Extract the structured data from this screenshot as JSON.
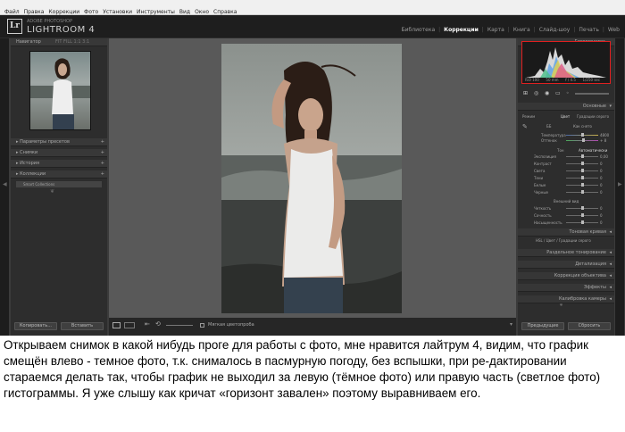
{
  "menu": [
    "Файл",
    "Правка",
    "Коррекции",
    "Фото",
    "Установки",
    "Инструменты",
    "Вид",
    "Окно",
    "Справка"
  ],
  "app": {
    "subtitle": "ADOBE PHOTOSHOP",
    "name": "LIGHTROOM 4",
    "logo": "Lr"
  },
  "modules": [
    {
      "label": "Библиотека",
      "active": false
    },
    {
      "label": "Коррекции",
      "active": true
    },
    {
      "label": "Карта",
      "active": false
    },
    {
      "label": "Книга",
      "active": false
    },
    {
      "label": "Слайд-шоу",
      "active": false
    },
    {
      "label": "Печать",
      "active": false
    },
    {
      "label": "Web",
      "active": false
    }
  ],
  "left_panel": {
    "navigator": {
      "title": "Навигатор",
      "zoom": "FIT   FILL   1:1   3:1"
    },
    "sections": [
      "Параметры пресетов",
      "Снимки",
      "История",
      "Коллекции"
    ],
    "collection_item": "Smart Collections",
    "copy_button": "Копировать...",
    "paste_button": "Вставить"
  },
  "right_panel": {
    "histogram": {
      "title": "Гистограмма",
      "iso": "ISO 100",
      "focal": "50 mm",
      "aperture": "f / 4.5",
      "shutter": "1/250 sec"
    },
    "basic": {
      "title": "Основные",
      "treatment_label": "Режим",
      "color_label": "Цвет",
      "bw_label": "Градации серого",
      "wb_label": "ББ",
      "wb_value": "Как снято",
      "temp_label": "Температура",
      "temp_value": "4800",
      "tint_label": "Оттенок",
      "tint_value": "+ 8",
      "tone_label": "Тон",
      "auto_label": "Автоматически",
      "tone_sliders": [
        "Экспозиция",
        "Контраст",
        "Света",
        "Тени",
        "Белые",
        "Черные"
      ],
      "tone_values": [
        "0,00",
        "0",
        "0",
        "0",
        "0",
        "0"
      ],
      "presence_label": "Внешний вид",
      "presence_sliders": [
        "Четкость",
        "Сочность",
        "Насыщенность"
      ],
      "presence_values": [
        "0",
        "0",
        "0"
      ]
    },
    "sections": [
      "Тоновая кривая",
      "Раздельное тонирование",
      "Детализация",
      "Коррекция объектива",
      "Эффекты",
      "Калибровка камеры"
    ],
    "hsl_tabs": "HSL  /  Цвет  /  Градации серого",
    "previous_button": "Предыдущие",
    "reset_button": "Сбросить"
  },
  "toolbar": {
    "softproof": "Мягкая цветопроба"
  },
  "caption": "Открываем снимок в какой нибудь проге для работы с фото, мне нравится лайтрум 4, видим, что график смещён влево - темное фото, т.к. снималось в пасмурную погоду, без вспышки, при ре-дактировании стараемся делать так, чтобы график не выходил за левую (тёмное фото) или правую часть (светлое фото) гистограммы. Я уже слышу как кричат «горизонт завален» поэтому выравниваем его.",
  "colors": {
    "accent": "#e02020",
    "panel": "#2d2d2d",
    "background": "#3b3b3b"
  }
}
